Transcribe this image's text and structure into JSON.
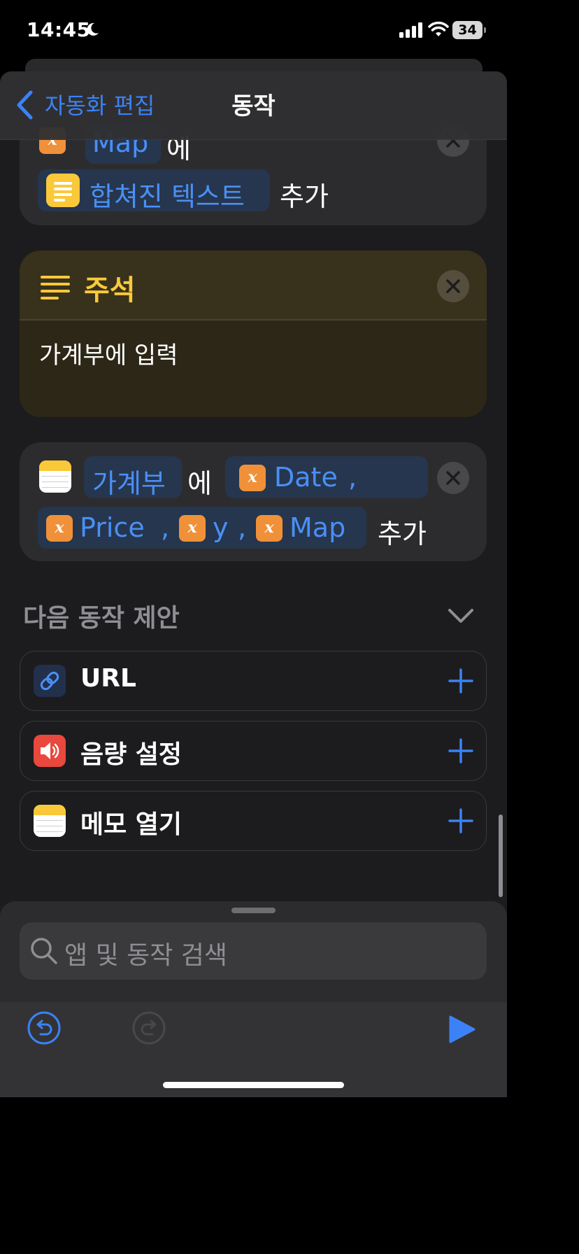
{
  "status_bar": {
    "time": "14:45",
    "battery": "34"
  },
  "nav": {
    "back_label": "자동화 편집",
    "title": "동작"
  },
  "actions": [
    {
      "variable_target": "Map",
      "connector": "에",
      "value": "합쳐진 텍스트",
      "verb": "추가"
    },
    {
      "type": "comment",
      "title": "주석",
      "body": "가계부에 입력"
    },
    {
      "note": "가계부",
      "connector": "에",
      "variables": [
        "Date",
        "Price",
        "y",
        "Map"
      ],
      "separator": ",",
      "verb": "추가"
    }
  ],
  "suggestions": {
    "title": "다음 동작 제안",
    "items": [
      {
        "label": "URL",
        "icon": "link-icon"
      },
      {
        "label": "음량 설정",
        "icon": "speaker-icon"
      },
      {
        "label": "메모 열기",
        "icon": "notes-icon"
      }
    ]
  },
  "search": {
    "placeholder": "앱 및 동작 검색"
  },
  "colors": {
    "accent": "#3b82f6",
    "variable": "#f0913a",
    "comment": "#f9c93a"
  }
}
